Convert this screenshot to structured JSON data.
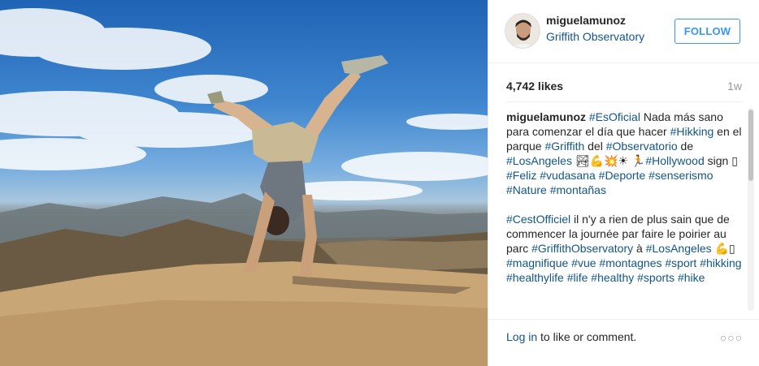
{
  "post": {
    "username": "miguelamunoz",
    "location": "Griffith Observatory",
    "follow_label": "FOLLOW",
    "likes": "4,742 likes",
    "time_ago": "1w",
    "caption": {
      "author": "miguelamunoz",
      "p1": {
        "t1": "#EsOficial",
        "t2": " Nada más sano para comenzar el día que hacer ",
        "t3": "#Hikking",
        "t4": " en el parque ",
        "t5": "#Griffith",
        "t6": " del ",
        "t7": "#Observatorio",
        "t8": " de ",
        "t9": "#LosAngeles",
        "t10": " 🏞💪💥☀ 🏃",
        "t11": "#Hollywood",
        "t12": " sign ▯ ",
        "t13": "#Feliz",
        "t14": " ",
        "t15": "#vudasana",
        "t16": " ",
        "t17": "#Deporte",
        "t18": " ",
        "t19": "#senserismo",
        "t20": " ",
        "t21": "#Nature",
        "t22": " ",
        "t23": "#montañas"
      },
      "p2": {
        "t1": "#CestOfficiel",
        "t2": " il n'y a rien de plus sain que de commencer la journée par faire le poirier au parc ",
        "t3": "#GriffithObservatory",
        "t4": " à ",
        "t5": "#LosAngeles",
        "t6": " 💪▯ ",
        "t7": "#magnifique",
        "t8": " ",
        "t9": "#vue",
        "t10": " ",
        "t11": "#montagnes",
        "t12": " ",
        "t13": "#sport",
        "t14": " ",
        "t15": "#hikking",
        "t16": " ",
        "t17": "#healthylife",
        "t18": " ",
        "t19": "#life",
        "t20": " ",
        "t21": "#healthy",
        "t22": " ",
        "t23": "#sports",
        "t24": " ",
        "t25": "#hike"
      }
    },
    "footer": {
      "login_link": "Log in",
      "login_text": " to like or comment.",
      "more_glyph": "○○○"
    }
  },
  "icons": {
    "more": "more-options-icon",
    "avatar": "user-avatar"
  },
  "colors": {
    "link": "#125688",
    "follow": "#3897f0",
    "muted": "#999999"
  }
}
